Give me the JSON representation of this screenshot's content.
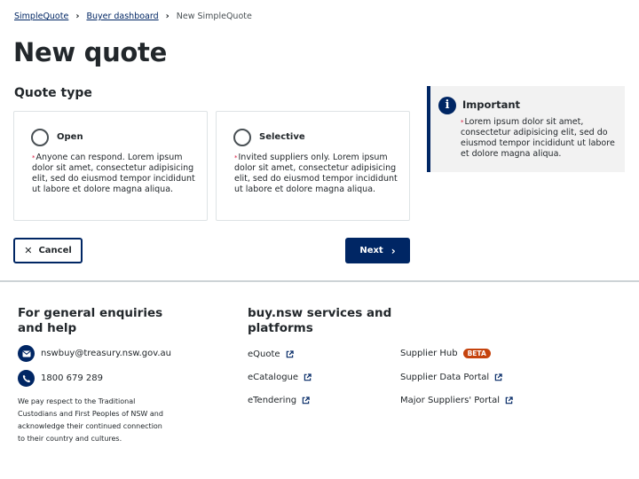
{
  "breadcrumb": {
    "items": [
      "SimpleQuote",
      "Buyer dashboard"
    ],
    "current": "New SimpleQuote"
  },
  "page": {
    "title": "New quote",
    "section_title": "Quote type"
  },
  "options": [
    {
      "label": "Open",
      "description": "Anyone can respond. Lorem ipsum dolor sit amet, consectetur adipisicing elit, sed do eiusmod tempor incididunt ut labore et dolore magna aliqua.",
      "selected": false
    },
    {
      "label": "Selective",
      "description": "Invited suppliers only. Lorem ipsum dolor sit amet, consectetur adipisicing elit, sed do eiusmod tempor incididunt ut labore et dolore magna aliqua.",
      "selected": false
    }
  ],
  "important": {
    "title": "Important",
    "body": "Lorem ipsum dolor sit amet, consectetur adipisicing elit, sed do eiusmod tempor incididunt ut labore et dolore magna aliqua."
  },
  "buttons": {
    "cancel": "Cancel",
    "next": "Next"
  },
  "footer": {
    "enquiries_heading": "For general enquiries and help",
    "email": "nswbuy@treasury.nsw.gov.au",
    "phone": "1800 679 289",
    "acknowledgement": "We pay respect to the Traditional Custodians and First Peoples of NSW and acknowledge their continued connection to their country and cultures.",
    "services_heading": "buy.nsw services and platforms",
    "links": [
      {
        "label": "eQuote"
      },
      {
        "label": "eCatalogue"
      },
      {
        "label": "eTendering"
      },
      {
        "label": "Supplier Hub",
        "badge": "BETA"
      },
      {
        "label": "Supplier Data Portal"
      },
      {
        "label": "Major Suppliers' Portal"
      }
    ]
  },
  "colors": {
    "primary": "#002664",
    "badge": "#c5430d",
    "asterisk": "#d7153a"
  },
  "icons": {
    "info": "info-icon",
    "email": "email-icon",
    "phone": "phone-icon",
    "external": "external-link-icon",
    "breadcrumb_separator": "chevron-right-icon"
  }
}
